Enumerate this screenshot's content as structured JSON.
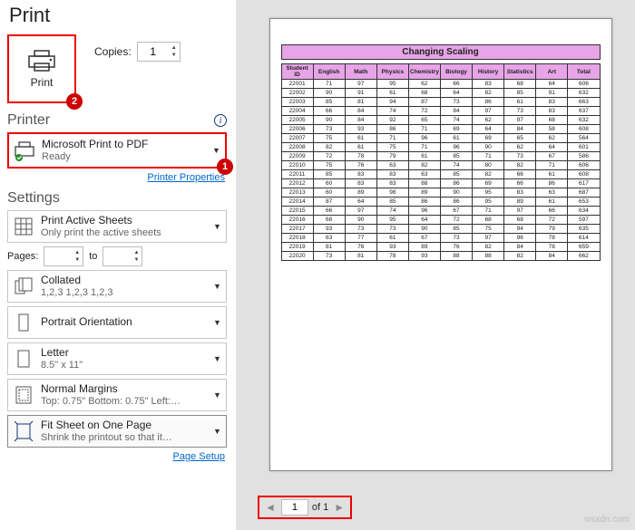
{
  "page_title": "Print",
  "print": {
    "tile_label": "Print",
    "copies_label": "Copies:",
    "copies_value": "1"
  },
  "badges": {
    "printer": "1",
    "print_button": "2"
  },
  "printer_section": {
    "heading": "Printer",
    "name": "Microsoft Print to PDF",
    "status": "Ready",
    "properties_link": "Printer Properties"
  },
  "settings_section": {
    "heading": "Settings",
    "sheets_ln1": "Print Active Sheets",
    "sheets_ln2": "Only print the active sheets",
    "pages_label": "Pages:",
    "pages_to": "to",
    "collate_ln1": "Collated",
    "collate_ln2": "1,2,3   1,2,3   1,2,3",
    "orient_ln1": "Portrait Orientation",
    "paper_ln1": "Letter",
    "paper_ln2": "8.5\" x 11\"",
    "margins_ln1": "Normal Margins",
    "margins_ln2": "Top: 0.75\" Bottom: 0.75\" Left:…",
    "scaling_ln1": "Fit Sheet on One Page",
    "scaling_ln2": "Shrink the printout so that it…",
    "page_setup_link": "Page Setup"
  },
  "nav": {
    "page": "1",
    "of_label": "of 1"
  },
  "watermark": "wsxdn.com",
  "chart_data": {
    "type": "table",
    "title": "Changing Scaling",
    "columns": [
      "Student ID",
      "English",
      "Math",
      "Physics",
      "Chemistry",
      "Biology",
      "History",
      "Statistics",
      "Art",
      "Total"
    ],
    "rows": [
      [
        "22001",
        "71",
        "97",
        "95",
        "62",
        "66",
        "83",
        "68",
        "64",
        "606"
      ],
      [
        "22002",
        "90",
        "91",
        "61",
        "68",
        "64",
        "82",
        "85",
        "91",
        "632"
      ],
      [
        "22003",
        "85",
        "81",
        "94",
        "87",
        "73",
        "86",
        "61",
        "83",
        "663"
      ],
      [
        "22004",
        "66",
        "84",
        "74",
        "72",
        "84",
        "97",
        "73",
        "83",
        "637"
      ],
      [
        "22005",
        "90",
        "84",
        "92",
        "65",
        "74",
        "62",
        "97",
        "68",
        "632"
      ],
      [
        "22006",
        "73",
        "93",
        "86",
        "71",
        "69",
        "64",
        "84",
        "58",
        "608"
      ],
      [
        "22007",
        "75",
        "61",
        "71",
        "96",
        "61",
        "69",
        "65",
        "62",
        "564"
      ],
      [
        "22008",
        "82",
        "61",
        "75",
        "71",
        "96",
        "90",
        "62",
        "64",
        "601"
      ],
      [
        "22009",
        "72",
        "78",
        "79",
        "61",
        "85",
        "71",
        "73",
        "67",
        "586"
      ],
      [
        "22010",
        "75",
        "76",
        "63",
        "82",
        "74",
        "80",
        "82",
        "71",
        "606"
      ],
      [
        "22011",
        "85",
        "83",
        "83",
        "63",
        "85",
        "82",
        "66",
        "61",
        "608"
      ],
      [
        "22012",
        "60",
        "83",
        "83",
        "88",
        "86",
        "69",
        "66",
        "86",
        "617"
      ],
      [
        "22013",
        "60",
        "89",
        "98",
        "89",
        "90",
        "95",
        "83",
        "63",
        "687"
      ],
      [
        "22014",
        "87",
        "64",
        "85",
        "86",
        "86",
        "95",
        "89",
        "61",
        "653"
      ],
      [
        "22015",
        "66",
        "97",
        "74",
        "96",
        "67",
        "71",
        "97",
        "66",
        "634"
      ],
      [
        "22016",
        "68",
        "90",
        "95",
        "64",
        "72",
        "68",
        "68",
        "72",
        "597"
      ],
      [
        "22017",
        "93",
        "73",
        "73",
        "90",
        "85",
        "75",
        "94",
        "79",
        "635"
      ],
      [
        "22018",
        "63",
        "77",
        "61",
        "67",
        "73",
        "97",
        "96",
        "78",
        "614"
      ],
      [
        "22019",
        "81",
        "76",
        "93",
        "89",
        "76",
        "82",
        "84",
        "78",
        "659"
      ],
      [
        "22020",
        "73",
        "81",
        "78",
        "93",
        "88",
        "88",
        "82",
        "84",
        "662"
      ]
    ]
  }
}
